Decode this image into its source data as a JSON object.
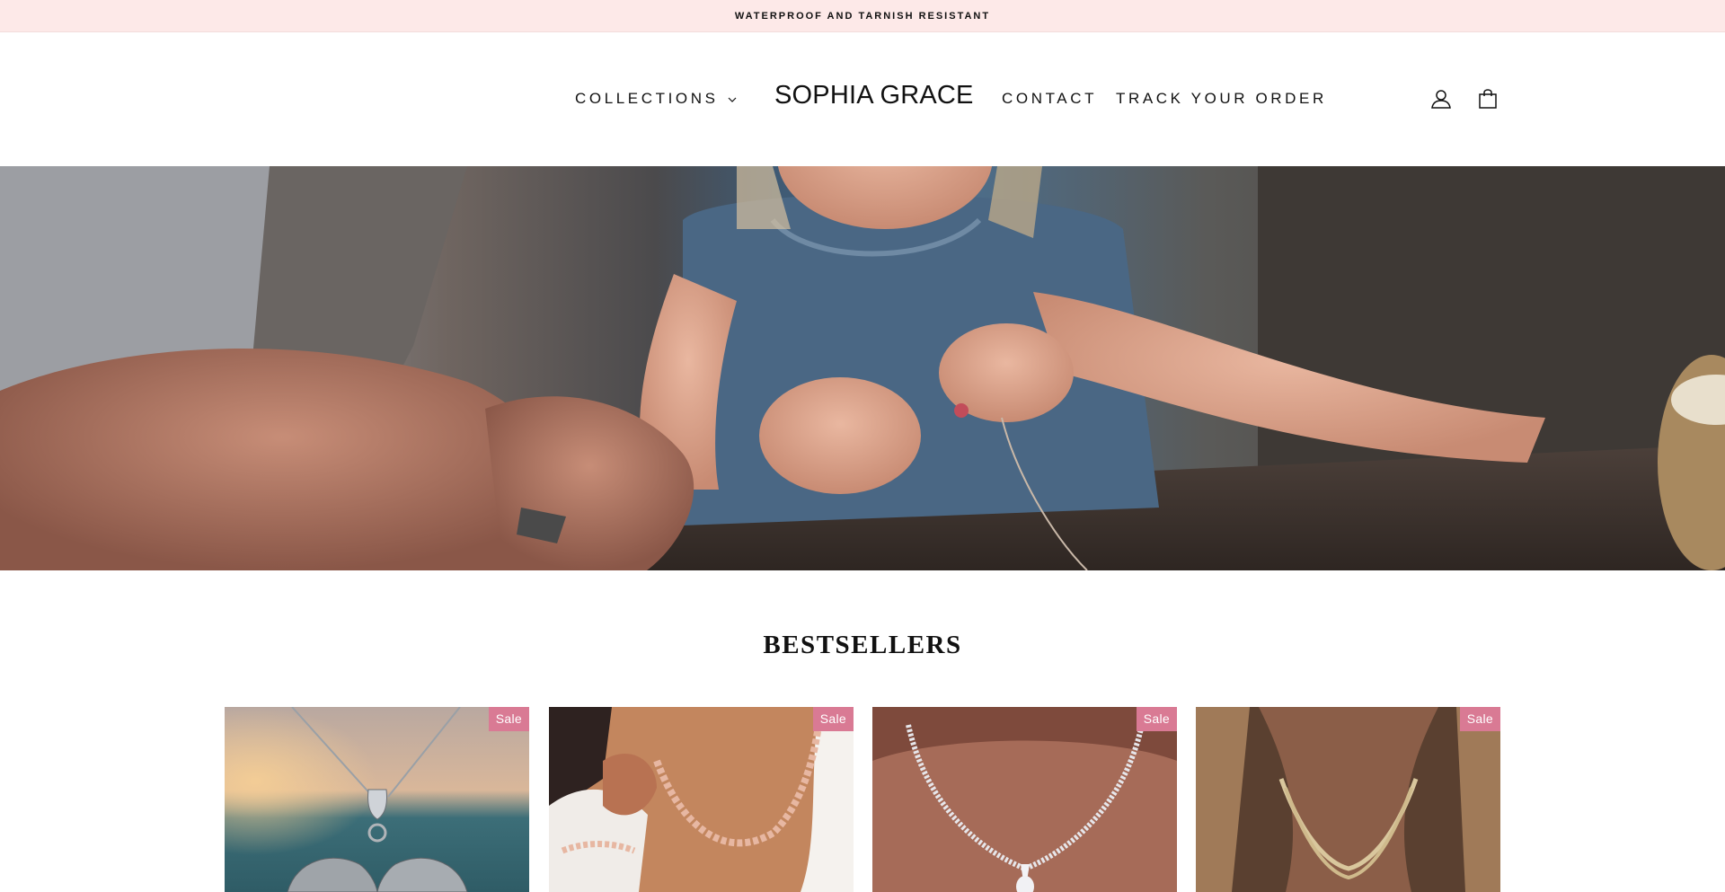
{
  "announcement": {
    "text": "WATERPROOF AND TARNISH RESISTANT"
  },
  "header": {
    "logo": "SOPHIA GRACE",
    "nav": {
      "collections": "COLLECTIONS",
      "contact": "CONTACT",
      "track": "TRACK YOUR ORDER"
    },
    "icons": {
      "account": "user-icon",
      "cart": "shopping-bag-icon"
    }
  },
  "hero": {
    "image": "grandmother-and-child-beading-photo"
  },
  "bestsellers": {
    "title": "BESTSELLERS",
    "products": [
      {
        "badge": "Sale",
        "image": "dolphin-heart-pendant-photo"
      },
      {
        "badge": "Sale",
        "image": "rose-gold-necklace-bracelet-photo"
      },
      {
        "badge": "Sale",
        "image": "diamond-tennis-necklace-photo"
      },
      {
        "badge": "Sale",
        "image": "gold-rope-choker-photo"
      }
    ]
  },
  "colors": {
    "announcement_bg": "#fde9e8",
    "badge_bg": "#d97a94",
    "text": "#111111"
  }
}
